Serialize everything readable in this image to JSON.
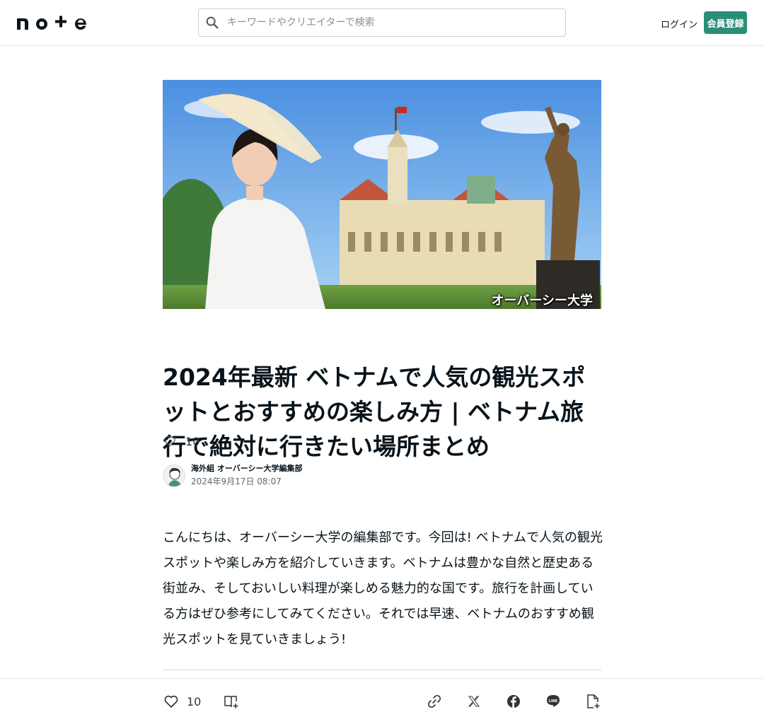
{
  "header": {
    "logo_text": "note",
    "search_placeholder": "キーワードやクリエイターで検索",
    "login_label": "ログイン",
    "signup_label": "会員登録"
  },
  "hero": {
    "caption": "オーバーシー大学"
  },
  "article": {
    "title": "2024年最新 ベトナムで人気の観光スポットとおすすめの楽しみ方 | ベトナム旅行で絶対に行きたい場所まとめ",
    "like_count": "10",
    "author_name": "海外組 オーバーシー大学編集部",
    "date": "2024年9月17日 08:07",
    "body": "こんにちは、オーバーシー大学の編集部です。今回は! ベトナムで人気の観光スポットや楽しみ方を紹介していきます。ベトナムは豊かな自然と歴史ある街並み、そしておいしい料理が楽しめる魅力的な国です。旅行を計画している方はぜひ参考にしてみてください。それでは早速、ベトナムのおすすめ観光スポットを見ていきましょう!"
  },
  "bottom_bar": {
    "like_count": "10"
  },
  "icons": {
    "search": "search-icon",
    "heart": "heart-icon",
    "magazine": "add-to-magazine-icon",
    "link": "link-icon",
    "x": "x-icon",
    "facebook": "facebook-icon",
    "line": "line-icon",
    "embed": "embed-icon"
  },
  "colors": {
    "accent": "#2a8e78",
    "text": "#08131a"
  }
}
